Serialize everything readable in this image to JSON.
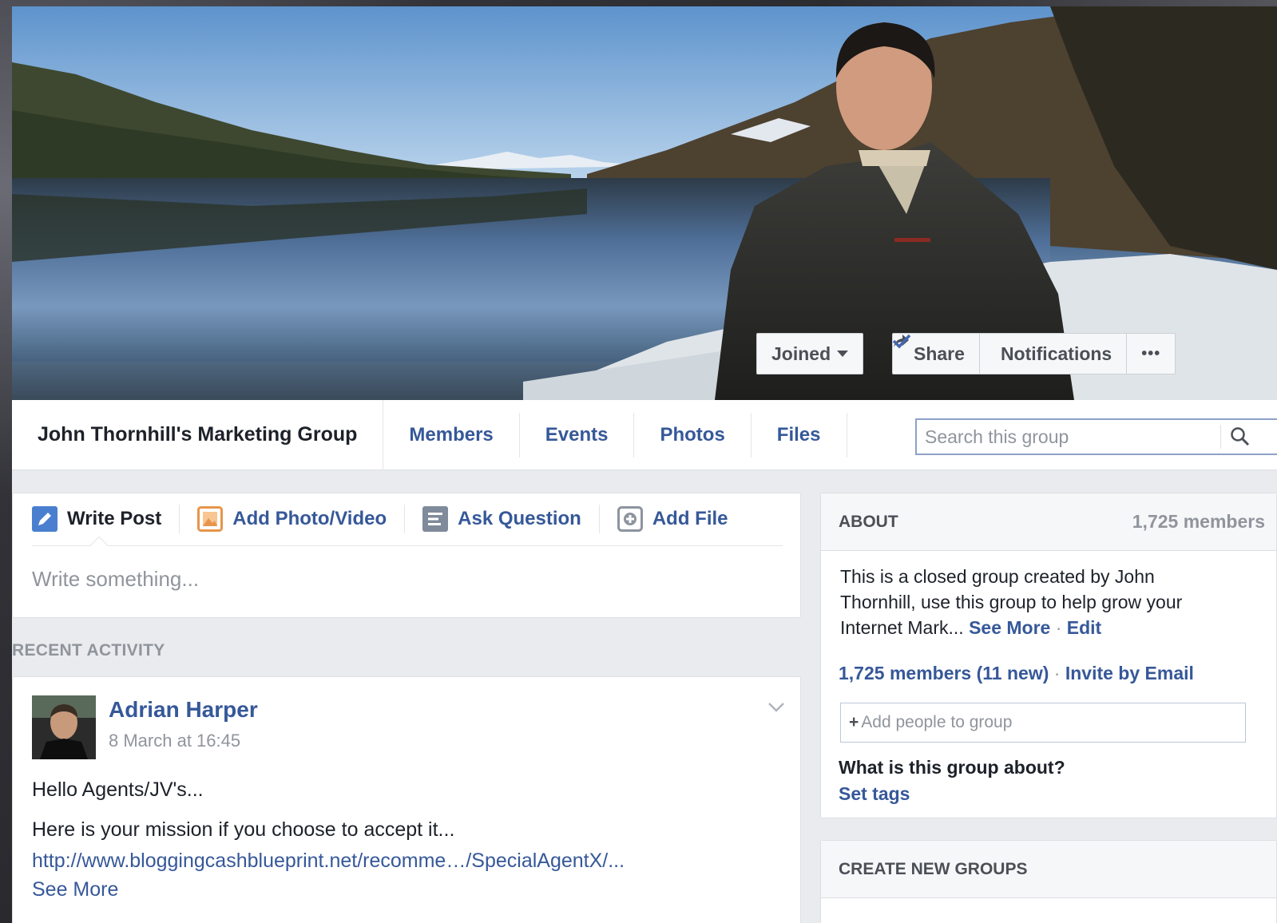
{
  "cover": {
    "joined_label": "Joined",
    "share_label": "Share",
    "notifications_label": "Notifications",
    "more_label": "•••"
  },
  "nav": {
    "group_title": "John Thornhill's Marketing Group",
    "tabs": [
      "Members",
      "Events",
      "Photos",
      "Files"
    ],
    "search_placeholder": "Search this group"
  },
  "composer": {
    "tabs": [
      "Write Post",
      "Add Photo/Video",
      "Ask Question",
      "Add File"
    ],
    "placeholder": "Write something..."
  },
  "recent_activity_label": "RECENT ACTIVITY",
  "post": {
    "author": "Adrian Harper",
    "time": "8 March at 16:45",
    "line1": "Hello Agents/JV's...",
    "line2": "Here is your mission if you choose to accept it...",
    "link": "http://www.bloggingcashblueprint.net/recomme…/SpecialAgentX/...",
    "see_more": "See More"
  },
  "about": {
    "title": "ABOUT",
    "count": "1,725 members",
    "desc": "This is a closed group created by John Thornhill, use this group to help grow your Internet Mark...",
    "see_more": "See More",
    "sep": "·",
    "edit": "Edit",
    "members": "1,725 members",
    "new_count": "(11 new)",
    "invite": "Invite by Email",
    "add_people_plus": "+",
    "add_people": "Add people to group",
    "question": "What is this group about?",
    "set_tags": "Set tags"
  },
  "create_groups": {
    "title": "CREATE NEW GROUPS"
  },
  "colors": {
    "link": "#365899",
    "accent": "#4267b2",
    "muted": "#90949c",
    "page_bg": "#e9ebee"
  }
}
